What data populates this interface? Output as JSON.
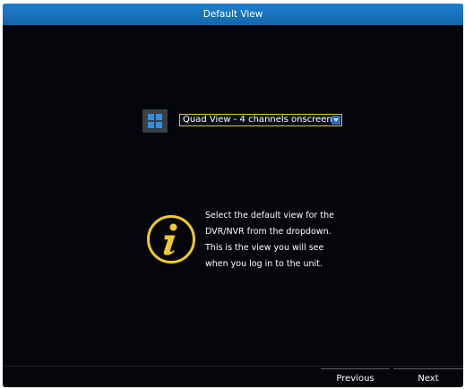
{
  "window": {
    "title": "Default View"
  },
  "view_selector": {
    "icon": "quad-layout-icon",
    "selected_value": "Quad View - 4 channels onscreen",
    "dropdown_icon": "chevron-down-icon"
  },
  "info": {
    "icon": "info-icon",
    "lines": [
      "Select the default view for the",
      "DVR/NVR from the dropdown.",
      "This is the view you will see",
      "when you log in to the unit."
    ]
  },
  "footer": {
    "previous_label": "Previous",
    "next_label": "Next"
  },
  "colors": {
    "title_bar": "#1a74bf",
    "background": "#04060c",
    "accent": "#e2c34a",
    "dropdown_button": "#2a6cc2"
  }
}
